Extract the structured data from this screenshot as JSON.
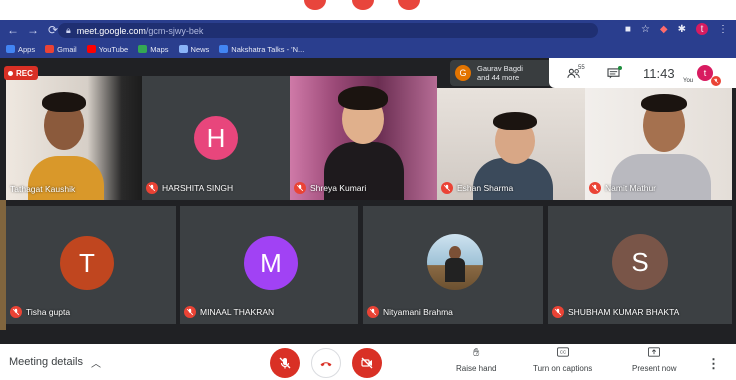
{
  "browser": {
    "url_host": "meet.google.com",
    "url_path": "/gcm-sjwy-bek",
    "profile_initial": "t",
    "bookmarks": [
      {
        "label": "Apps",
        "icon": "apps-grid-icon",
        "color": "#4285f4"
      },
      {
        "label": "Gmail",
        "icon": "gmail-icon",
        "color": "#ea4335"
      },
      {
        "label": "YouTube",
        "icon": "youtube-icon",
        "color": "#ff0000"
      },
      {
        "label": "Maps",
        "icon": "maps-icon",
        "color": "#34a853"
      },
      {
        "label": "News",
        "icon": "news-icon",
        "color": "#8ab4f8"
      },
      {
        "label": "Nakshatra Talks - 'N...",
        "icon": "bookmark-site-icon",
        "color": "#4285f4"
      }
    ]
  },
  "meeting": {
    "rec_label": "REC",
    "more_participants": {
      "initial": "G",
      "line1": "Gaurav Bagdi",
      "line2": "and 44 more"
    },
    "participant_count": "55",
    "time": "11:43",
    "you_label": "You",
    "you_initial": "t",
    "tiles": [
      {
        "name": "Tathagat Kaushik",
        "type": "video",
        "muted": false
      },
      {
        "name": "HARSHITA SINGH",
        "type": "avatar",
        "initial": "H",
        "color": "#e8467c",
        "muted": true
      },
      {
        "name": "Shreya Kumari",
        "type": "video",
        "muted": true
      },
      {
        "name": "Eshan Sharma",
        "type": "video",
        "muted": true
      },
      {
        "name": "Namit Mathur",
        "type": "video",
        "muted": true
      },
      {
        "name": "Tisha gupta",
        "type": "avatar",
        "initial": "T",
        "color": "#c0461f",
        "muted": true
      },
      {
        "name": "MINAAL THAKRAN",
        "type": "avatar",
        "initial": "M",
        "color": "#a142f4",
        "muted": true
      },
      {
        "name": "Nityamani Brahma",
        "type": "photo",
        "muted": true
      },
      {
        "name": "SHUBHAM KUMAR BHAKTA",
        "type": "avatar",
        "initial": "S",
        "color": "#795548",
        "muted": true
      }
    ]
  },
  "controls": {
    "meeting_details": "Meeting details",
    "raise_hand": "Raise hand",
    "captions": "Turn on captions",
    "present": "Present now"
  },
  "colors": {
    "danger": "#d93025",
    "chrome_bar": "#2a3e8e",
    "stage_bg": "#202124"
  }
}
